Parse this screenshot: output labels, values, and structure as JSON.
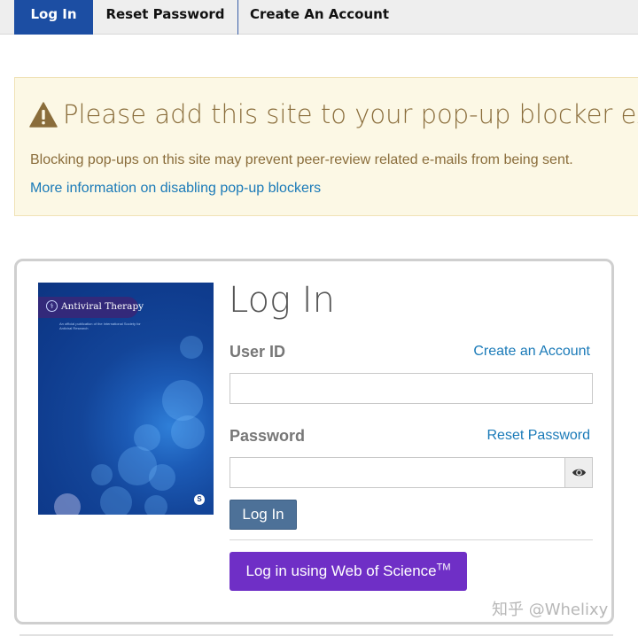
{
  "tabs": [
    {
      "label": "Log In",
      "active": true
    },
    {
      "label": "Reset Password",
      "active": false
    },
    {
      "label": "Create An Account",
      "active": false
    }
  ],
  "popup_alert": {
    "icon": "warning-icon",
    "heading": "Please add this site to your pop-up blocker exceptions",
    "body": "Blocking pop-ups on this site may prevent peer-review related e-mails from being sent.",
    "link": "More information on disabling pop-up blockers"
  },
  "journal_cover": {
    "title": "Antiviral Therapy",
    "subtitle": "An official publication of the International Society for Antiviral Research",
    "publisher_mark": "S"
  },
  "login": {
    "title": "Log In",
    "user_id_label": "User ID",
    "create_account_link": "Create an Account",
    "user_id_value": "",
    "password_label": "Password",
    "reset_password_link": "Reset Password",
    "password_value": "",
    "show_password_icon": "eye-icon",
    "submit_label": "Log In",
    "wos_label": "Log in using Web of Science",
    "wos_trademark": "TM"
  },
  "watermark": "知乎 @Whelixy",
  "colors": {
    "tab_active": "#1c4ea3",
    "alert_bg": "#fcf8e5",
    "alert_text": "#8a6d3b",
    "link": "#1a7ab8",
    "login_button": "#4d7198",
    "wos_button": "#6f2fc6"
  }
}
